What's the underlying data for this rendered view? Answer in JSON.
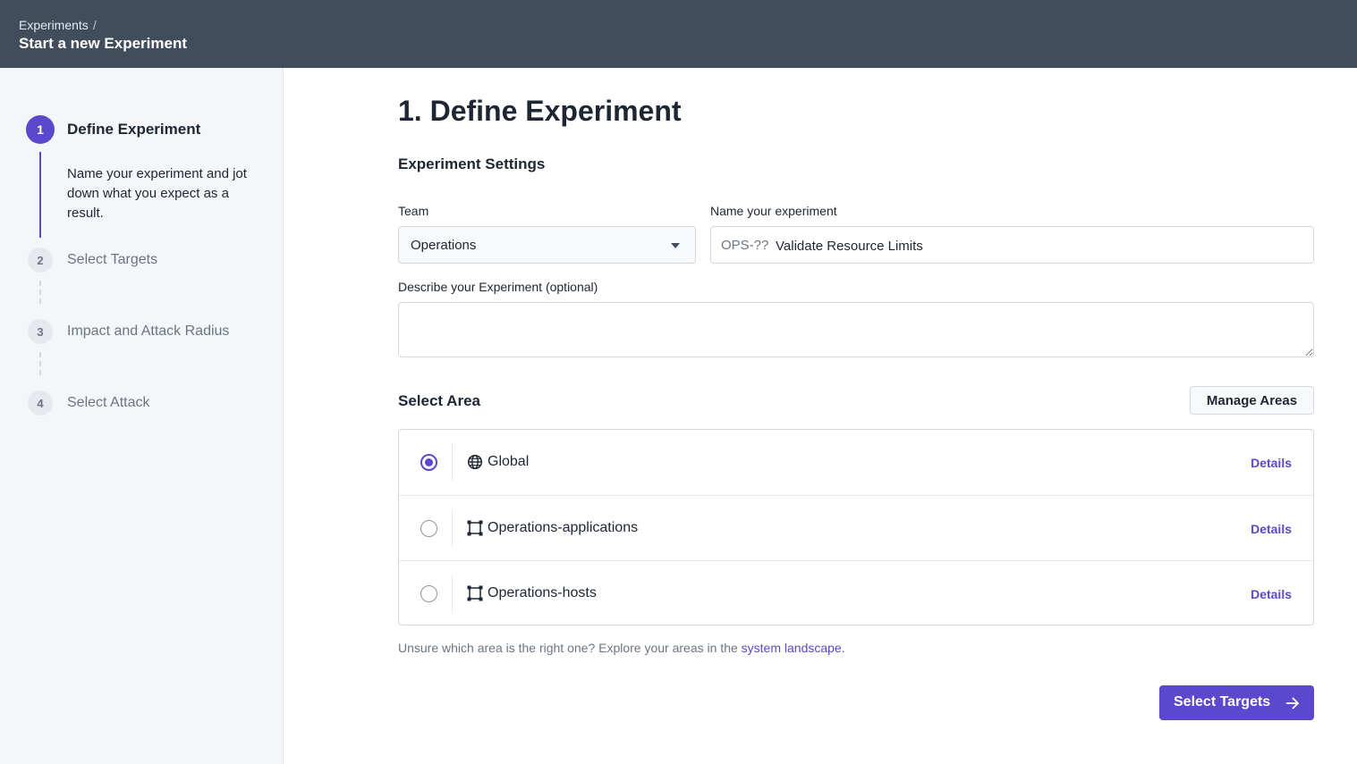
{
  "header": {
    "breadcrumb_root": "Experiments",
    "breadcrumb_sep": "/",
    "title": "Start a new Experiment"
  },
  "sidebar": {
    "steps": [
      {
        "number": "1",
        "label": "Define Experiment",
        "description": "Name your experiment and jot down what you expect as a result.",
        "active": true
      },
      {
        "number": "2",
        "label": "Select Targets",
        "active": false
      },
      {
        "number": "3",
        "label": "Impact and Attack Radius",
        "active": false
      },
      {
        "number": "4",
        "label": "Select Attack",
        "active": false
      }
    ]
  },
  "main": {
    "heading": "1. Define Experiment",
    "settings_heading": "Experiment Settings",
    "team_label": "Team",
    "team_value": "Operations",
    "name_label": "Name your experiment",
    "name_prefix": "OPS-??",
    "name_value": "Validate Resource Limits",
    "describe_label": "Describe your Experiment (optional)",
    "describe_value": "",
    "area_heading": "Select Area",
    "manage_areas": "Manage Areas",
    "areas": [
      {
        "name": "Global",
        "icon": "globe-icon",
        "selected": true,
        "details": "Details"
      },
      {
        "name": "Operations-applications",
        "icon": "area-frame-icon",
        "selected": false,
        "details": "Details"
      },
      {
        "name": "Operations-hosts",
        "icon": "area-frame-icon",
        "selected": false,
        "details": "Details"
      }
    ],
    "hint_text": "Unsure which area is the right one? Explore your areas in the",
    "hint_link": "system landscape.",
    "next_button": "Select Targets"
  },
  "colors": {
    "header_bg": "#424d5c",
    "accent": "#5b48cc",
    "sidebar_bg": "#f4f6f9"
  }
}
